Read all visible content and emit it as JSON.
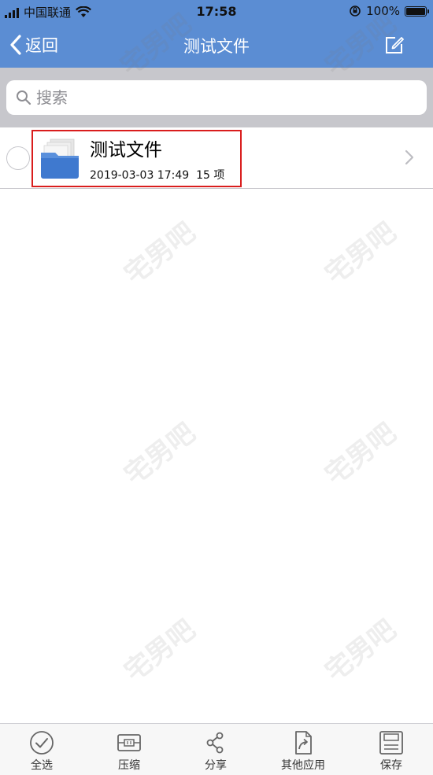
{
  "status_bar": {
    "carrier": "中国联通",
    "time": "17:58",
    "battery_percent": "100%"
  },
  "nav": {
    "back_label": "返回",
    "title": "测试文件"
  },
  "search": {
    "placeholder": "搜索"
  },
  "files": [
    {
      "name": "测试文件",
      "date": "2019-03-03 17:49",
      "count": "15 项"
    }
  ],
  "watermark_text": "宅男吧",
  "toolbar": {
    "select_all": "全选",
    "compress": "压缩",
    "share": "分享",
    "other_apps": "其他应用",
    "save": "保存"
  },
  "colors": {
    "nav_background": "#5b8dd3",
    "highlight": "#d91d1d",
    "folder": "#3f79cf"
  }
}
